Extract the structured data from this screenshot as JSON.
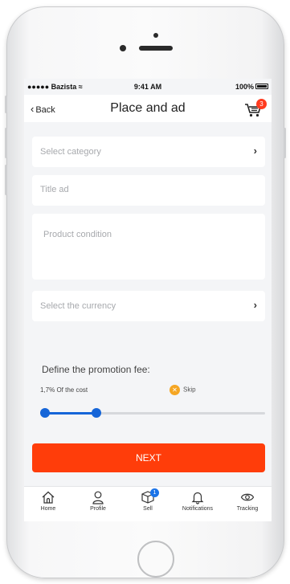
{
  "status_bar": {
    "carrier": "●●●●● Bazista ≈",
    "time": "9:41 AM",
    "battery": "100%"
  },
  "navbar": {
    "back_label": "Back",
    "title": "Place and ad",
    "cart_count": "3"
  },
  "form": {
    "category_placeholder": "Select category",
    "title_placeholder": "Title ad",
    "condition_placeholder": "Product condition",
    "currency_placeholder": "Select the currency"
  },
  "promotion": {
    "title": "Define the promotion fee:",
    "cost_label": "1,7% Of the cost",
    "skip_label": "Skip",
    "slider_value_fraction": 0.24
  },
  "next_label": "NEXT",
  "tabs": [
    {
      "label": "Home",
      "icon": "home-icon"
    },
    {
      "label": "Profile",
      "icon": "profile-icon"
    },
    {
      "label": "Sell",
      "icon": "box-icon",
      "badge": "1"
    },
    {
      "label": "Notifications",
      "icon": "bell-icon"
    },
    {
      "label": "Tracking",
      "icon": "eye-icon"
    }
  ],
  "colors": {
    "accent": "#ff3d0a",
    "slider": "#1565d8",
    "badge_blue": "#1a73e8",
    "skip_orange": "#f5a623"
  }
}
